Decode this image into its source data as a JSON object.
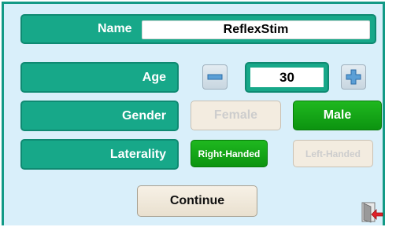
{
  "form": {
    "name_label": "Name",
    "name_value": "ReflexStim",
    "age_label": "Age",
    "age_value": "30",
    "gender_label": "Gender",
    "gender_options": [
      "Female",
      "Male"
    ],
    "gender_selected": "Male",
    "laterality_label": "Laterality",
    "laterality_options": [
      "Right-Handed",
      "Left-Handed"
    ],
    "laterality_selected": "Right-Handed",
    "continue_label": "Continue"
  },
  "icons": {
    "decrement": "minus-icon",
    "increment": "plus-icon",
    "exit": "exit-door-icon"
  },
  "colors": {
    "background": "#d9effa",
    "label_panel": "#17a889",
    "selected": "#12a416",
    "unselected": "#f3ece0"
  }
}
